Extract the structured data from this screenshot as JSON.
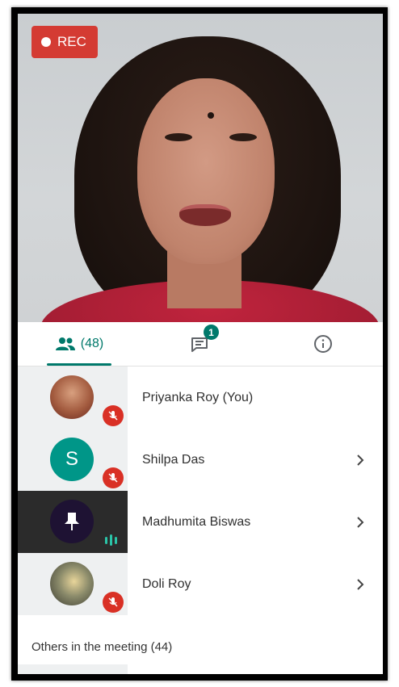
{
  "recording": {
    "label": "REC"
  },
  "tabs": {
    "people_count": "(48)",
    "chat_badge": "1"
  },
  "participants": [
    {
      "name": "Priyanka Roy (You)",
      "avatar": "photo",
      "status": "muted",
      "has_chevron": false
    },
    {
      "name": "Shilpa Das",
      "avatar_letter": "S",
      "avatar_color": "#009688",
      "status": "muted",
      "has_chevron": true
    },
    {
      "name": "Madhumita Biswas",
      "avatar": "pin-icon",
      "status": "speaking",
      "has_chevron": true
    },
    {
      "name": "Doli Roy",
      "avatar": "photo",
      "status": "muted",
      "has_chevron": true
    }
  ],
  "others": {
    "label": "Others in the meeting (44)"
  },
  "colors": {
    "accent": "#00796b",
    "rec": "#d43b33",
    "muted": "#d93025",
    "speaking": "#2bc4a8"
  }
}
